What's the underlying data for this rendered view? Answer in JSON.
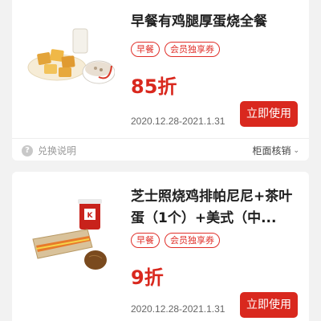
{
  "coupons": [
    {
      "title": "早餐有鸡腿厚蛋烧全餐",
      "tags": [
        "早餐",
        "会员独享券"
      ],
      "discount": "85折",
      "date_range": "2020.12.28-2021.1.31",
      "use_label": "立即使用"
    },
    {
      "title": "芝士照烧鸡排帕尼尼+茶叶蛋（1个）+美式（中...",
      "tags": [
        "早餐",
        "会员独享券"
      ],
      "discount": "9折",
      "date_range": "2020.12.28-2021.1.31",
      "use_label": "立即使用"
    }
  ],
  "footer": {
    "help_label": "兑换说明",
    "redeem_label": "柜面核销"
  },
  "colors": {
    "accent": "#d9281e",
    "background": "#f2f2f2"
  },
  "icons": {
    "help": "question-circle-icon",
    "chevron": "chevron-down-icon"
  }
}
